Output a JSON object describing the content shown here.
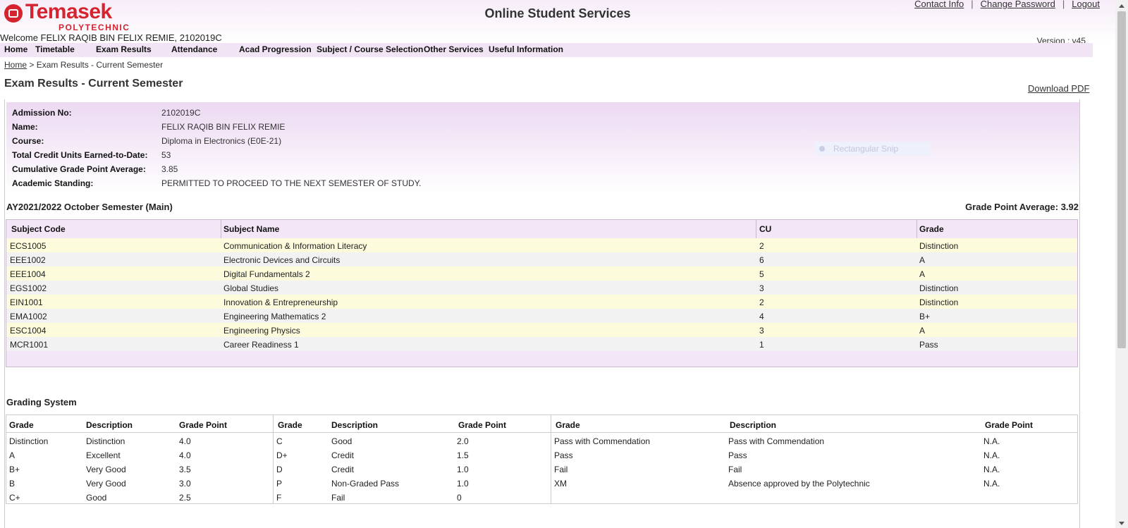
{
  "header": {
    "logo_text": "Temasek",
    "logo_sub": "POLYTECHNIC",
    "title": "Online Student Services",
    "links": {
      "contact": "Contact Info",
      "change_password": "Change Password",
      "logout": "Logout",
      "separator": "|"
    },
    "welcome": "Welcome FELIX RAQIB BIN FELIX REMIE, 2102019C",
    "version": "Version : v45"
  },
  "nav": [
    "Home",
    "Timetable",
    "Exam Results",
    "Attendance",
    "Acad Progression",
    "Subject / Course Selection",
    "Other Services",
    "Useful Information"
  ],
  "breadcrumb": {
    "home": "Home",
    "current": " > Exam Results - Current Semester"
  },
  "page_title": "Exam Results - Current Semester",
  "download_label": "Download PDF",
  "student": [
    {
      "label": "Admission No:",
      "value": "2102019C"
    },
    {
      "label": "Name:",
      "value": "FELIX RAQIB BIN FELIX REMIE"
    },
    {
      "label": "Course:",
      "value": "Diploma in Electronics (E0E-21)"
    },
    {
      "label": "Total Credit Units Earned-to-Date:",
      "value": "53"
    },
    {
      "label": "Cumulative Grade Point Average:",
      "value": "3.85"
    },
    {
      "label": "Academic Standing:",
      "value": "PERMITTED TO PROCEED TO THE NEXT SEMESTER OF STUDY."
    }
  ],
  "overlay": {
    "snip_label": "Rectangular Snip"
  },
  "semester": {
    "title": "AY2021/2022 October Semester (Main)",
    "gpa": "Grade Point Average: 3.92"
  },
  "results": {
    "headers": [
      "Subject Code",
      "Subject Name",
      "CU",
      "Grade"
    ],
    "rows": [
      [
        "ECS1005",
        "Communication & Information Literacy",
        "2",
        "Distinction"
      ],
      [
        "EEE1002",
        "Electronic Devices and Circuits",
        "6",
        "A"
      ],
      [
        "EEE1004",
        "Digital Fundamentals 2",
        "5",
        "A"
      ],
      [
        "EGS1002",
        "Global Studies",
        "3",
        "Distinction"
      ],
      [
        "EIN1001",
        "Innovation & Entrepreneurship",
        "2",
        "Distinction"
      ],
      [
        "EMA1002",
        "Engineering Mathematics 2",
        "4",
        "B+"
      ],
      [
        "ESC1004",
        "Engineering Physics",
        "3",
        "A"
      ],
      [
        "MCR1001",
        "Career Readiness 1",
        "1",
        "Pass"
      ]
    ]
  },
  "grading": {
    "title": "Grading System",
    "group1": {
      "headers": [
        "Grade",
        "Description",
        "Grade Point"
      ],
      "rows": [
        [
          "Distinction",
          "Distinction",
          "4.0"
        ],
        [
          "A",
          "Excellent",
          "4.0"
        ],
        [
          "B+",
          "Very Good",
          "3.5"
        ],
        [
          "B",
          "Very Good",
          "3.0"
        ],
        [
          "C+",
          "Good",
          "2.5"
        ]
      ]
    },
    "group2": {
      "headers": [
        "Grade",
        "Description",
        "Grade Point"
      ],
      "rows": [
        [
          "C",
          "Good",
          "2.0"
        ],
        [
          "D+",
          "Credit",
          "1.5"
        ],
        [
          "D",
          "Credit",
          "1.0"
        ],
        [
          "P",
          "Non-Graded Pass",
          "1.0"
        ],
        [
          "F",
          "Fail",
          "0"
        ]
      ]
    },
    "group3": {
      "headers": [
        "Grade",
        "Description",
        "Grade Point"
      ],
      "rows": [
        [
          "Pass with Commendation",
          "Pass with Commendation",
          "N.A."
        ],
        [
          "Pass",
          "Pass",
          "N.A."
        ],
        [
          "Fail",
          "Fail",
          "N.A."
        ],
        [
          "XM",
          "Absence approved by the Polytechnic",
          "N.A."
        ]
      ]
    }
  }
}
